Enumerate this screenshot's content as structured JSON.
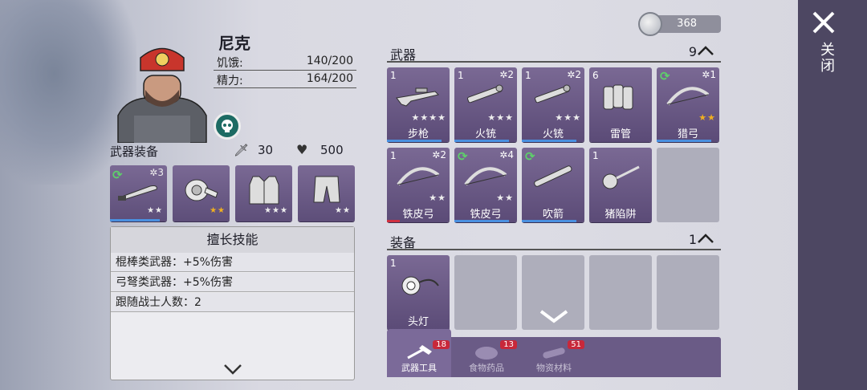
{
  "character": {
    "name": "尼克",
    "stats": [
      {
        "label": "饥饿:",
        "value": "140/200"
      },
      {
        "label": "精力:",
        "value": "164/200"
      }
    ]
  },
  "equipment_bar": {
    "title": "武器装备",
    "attack": "30",
    "health": "500"
  },
  "equipped_slots": [
    {
      "icon": "machete-icon",
      "stars": "★★",
      "gold": false,
      "level": "3",
      "refresh": true
    },
    {
      "icon": "bandage-icon",
      "stars": "★★",
      "gold": true
    },
    {
      "icon": "vest-icon",
      "stars": "★★★",
      "gold": false
    },
    {
      "icon": "pants-icon",
      "stars": "★★",
      "gold": false
    }
  ],
  "skills": {
    "title": "擅长技能",
    "lines": [
      "棍棒类武器：+5%伤害",
      "弓弩类武器：+5%伤害",
      "跟随战士人数：2"
    ]
  },
  "currency": {
    "amount": "368"
  },
  "weapons": {
    "title": "武器",
    "count": "9",
    "items": [
      {
        "qty": "1",
        "level": "",
        "name": "步枪",
        "stars": "★★★★",
        "gold": false,
        "icon": "rifle-icon",
        "refresh": false,
        "bar": "blue"
      },
      {
        "qty": "1",
        "level": "2",
        "name": "火铳",
        "stars": "★★★",
        "gold": false,
        "icon": "gun-icon",
        "refresh": false,
        "bar": "blue"
      },
      {
        "qty": "1",
        "level": "2",
        "name": "火铳",
        "stars": "★★★",
        "gold": false,
        "icon": "gun-icon",
        "refresh": false,
        "bar": "blue"
      },
      {
        "qty": "6",
        "level": "",
        "name": "雷管",
        "stars": "",
        "gold": false,
        "icon": "dynamite-icon",
        "refresh": false,
        "bar": ""
      },
      {
        "qty": "",
        "level": "1",
        "name": "猎弓",
        "stars": "★★",
        "gold": true,
        "icon": "bow-icon",
        "refresh": true,
        "bar": "blue"
      },
      {
        "qty": "1",
        "level": "2",
        "name": "铁皮弓",
        "stars": "★★",
        "gold": false,
        "icon": "bow-icon",
        "refresh": false,
        "bar": "red"
      },
      {
        "qty": "",
        "level": "4",
        "name": "铁皮弓",
        "stars": "★★",
        "gold": false,
        "icon": "bow-icon",
        "refresh": true,
        "bar": "blue"
      },
      {
        "qty": "",
        "level": "",
        "name": "吹箭",
        "stars": "",
        "gold": false,
        "icon": "blowgun-icon",
        "refresh": true,
        "bar": "blue"
      },
      {
        "qty": "1",
        "level": "",
        "name": "猪陷阱",
        "stars": "",
        "gold": false,
        "icon": "trap-icon",
        "refresh": false,
        "bar": ""
      }
    ]
  },
  "gear": {
    "title": "装备",
    "count": "1",
    "items": [
      {
        "qty": "1",
        "name": "头灯",
        "icon": "headlamp-icon"
      }
    ]
  },
  "tabs": [
    {
      "label": "武器工具",
      "badge": "18",
      "active": true,
      "icon": "tools-icon"
    },
    {
      "label": "食物药品",
      "badge": "13",
      "active": false,
      "icon": "food-icon"
    },
    {
      "label": "物资材料",
      "badge": "51",
      "active": false,
      "icon": "materials-icon"
    }
  ],
  "close": {
    "label": "关闭"
  },
  "colors": {
    "slot": "#6b5a88",
    "accent_blue": "#4a90e0",
    "accent_red": "#d03040",
    "gold_star": "#f0b020",
    "refresh_green": "#5ed06a"
  }
}
